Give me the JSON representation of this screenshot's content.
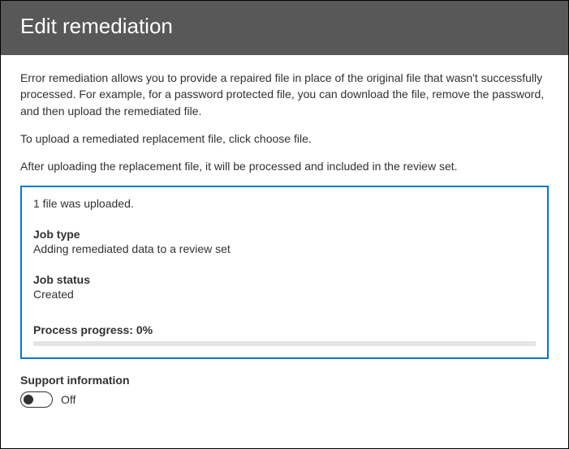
{
  "header": {
    "title": "Edit remediation"
  },
  "descriptions": {
    "intro": "Error remediation allows you to provide a repaired file in place of the original file that wasn't successfully processed. For example, for a password protected file, you can download the file, remove the password, and then upload the remediated file.",
    "upload_hint": "To upload a remediated replacement file, click choose file.",
    "after_upload": "After uploading the replacement file, it will be processed and included in the review set."
  },
  "status": {
    "upload_message": "1 file was uploaded.",
    "job_type_label": "Job type",
    "job_type_value": "Adding remediated data to a review set",
    "job_status_label": "Job status",
    "job_status_value": "Created",
    "progress_label": "Process progress: 0%",
    "progress_percent": 0
  },
  "support": {
    "title": "Support information",
    "toggle_state": "Off"
  }
}
